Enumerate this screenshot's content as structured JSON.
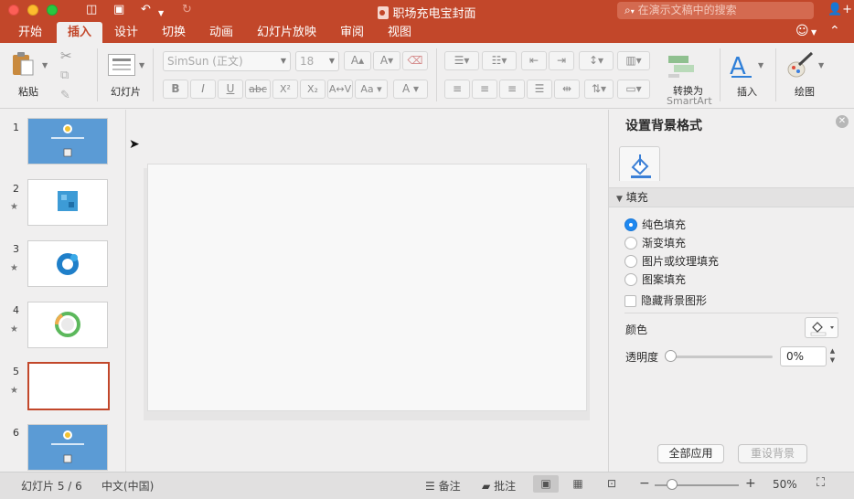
{
  "window": {
    "title": "职场充电宝封面",
    "search_placeholder": "在演示文稿中的搜索"
  },
  "tabs": [
    {
      "label": "开始"
    },
    {
      "label": "插入"
    },
    {
      "label": "设计"
    },
    {
      "label": "切换"
    },
    {
      "label": "动画"
    },
    {
      "label": "幻灯片放映"
    },
    {
      "label": "审阅"
    },
    {
      "label": "视图"
    }
  ],
  "ribbon": {
    "paste_label": "粘贴",
    "slides_label": "幻灯片",
    "font_name": "SimSun (正文)",
    "font_size": "18",
    "bold": "B",
    "italic": "I",
    "underline": "U",
    "strikethrough": "abc",
    "superscript": "X²",
    "subscript": "X₂",
    "convert_smartart_line1": "转换为",
    "convert_smartart_line2": "SmartArt",
    "insert_label": "插入",
    "draw_label": "绘图"
  },
  "slides": [
    {
      "number": "1",
      "star": ""
    },
    {
      "number": "2",
      "star": "★"
    },
    {
      "number": "3",
      "star": "★"
    },
    {
      "number": "4",
      "star": "★"
    },
    {
      "number": "5",
      "star": "★"
    },
    {
      "number": "6",
      "star": ""
    }
  ],
  "format_pane": {
    "title": "设置背景格式",
    "section": "填充",
    "options": [
      "纯色填充",
      "渐变填充",
      "图片或纹理填充",
      "图案填充"
    ],
    "selected_option": "纯色填充",
    "hide_bg_graphics": "隐藏背景图形",
    "color_label": "颜色",
    "transparency_label": "透明度",
    "transparency_value": "0%",
    "apply_all": "全部应用",
    "reset_background": "重设背景"
  },
  "status": {
    "slide_info": "幻灯片 5 / 6",
    "language": "中文(中国)",
    "notes": "备注",
    "comments": "批注",
    "zoom_text": "50%"
  }
}
